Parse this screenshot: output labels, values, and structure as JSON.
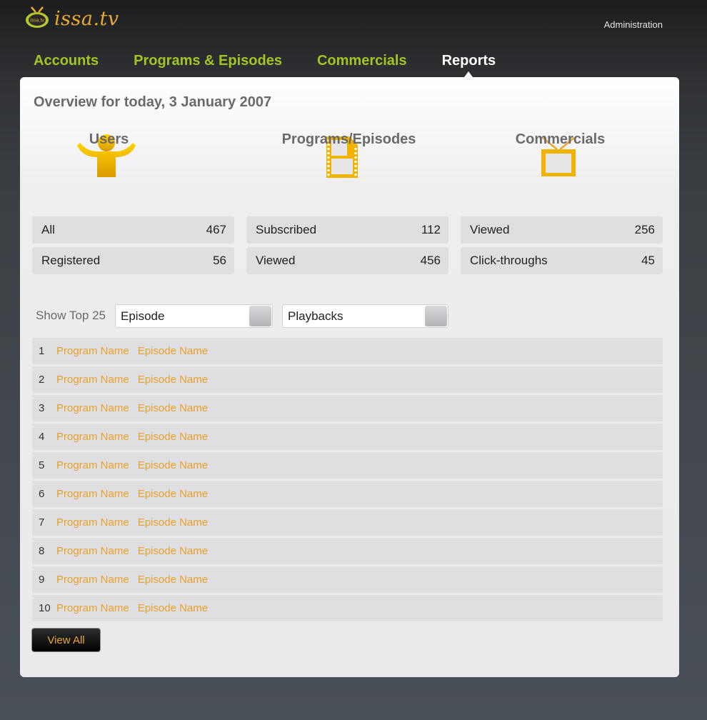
{
  "brand": {
    "logo_badge": "issa.tv",
    "name": "issa.tv"
  },
  "header": {
    "admin_link": "Administration"
  },
  "nav": {
    "tabs": [
      {
        "label": "Accounts",
        "active": false
      },
      {
        "label": "Programs & Episodes",
        "active": false
      },
      {
        "label": "Commercials",
        "active": false
      },
      {
        "label": "Reports",
        "active": true
      }
    ]
  },
  "overview": {
    "title": "Overview for today, 3 January 2007",
    "columns": [
      {
        "heading": "Users",
        "icon": "user-icon",
        "rows": [
          {
            "label": "All",
            "value": "467"
          },
          {
            "label": "Registered",
            "value": "56"
          }
        ]
      },
      {
        "heading": "Programs/Episodes",
        "icon": "film-icon",
        "rows": [
          {
            "label": "Subscribed",
            "value": "112"
          },
          {
            "label": "Viewed",
            "value": "456"
          }
        ]
      },
      {
        "heading": "Commercials",
        "icon": "tv-icon",
        "rows": [
          {
            "label": "Viewed",
            "value": "256"
          },
          {
            "label": "Click-throughs",
            "value": "45"
          }
        ]
      }
    ]
  },
  "filter": {
    "show_top_label": "Show Top 25",
    "type_select": "Episode",
    "metric_select": "Playbacks"
  },
  "top_list": [
    {
      "rank": "1",
      "program": "Program Name",
      "episode": "Episode Name"
    },
    {
      "rank": "2",
      "program": "Program Name",
      "episode": "Episode Name"
    },
    {
      "rank": "3",
      "program": "Program Name",
      "episode": "Episode Name"
    },
    {
      "rank": "4",
      "program": "Program Name",
      "episode": "Episode Name"
    },
    {
      "rank": "5",
      "program": "Program Name",
      "episode": "Episode Name"
    },
    {
      "rank": "6",
      "program": "Program Name",
      "episode": "Episode Name"
    },
    {
      "rank": "7",
      "program": "Program Name",
      "episode": "Episode Name"
    },
    {
      "rank": "8",
      "program": "Program Name",
      "episode": "Episode Name"
    },
    {
      "rank": "9",
      "program": "Program Name",
      "episode": "Episode Name"
    },
    {
      "rank": "10",
      "program": "Program Name",
      "episode": "Episode Name"
    }
  ],
  "view_all_label": "View All",
  "colors": {
    "accent_green": "#a3c520",
    "accent_orange": "#e9a92c",
    "icon_gold": "#f0b400"
  }
}
